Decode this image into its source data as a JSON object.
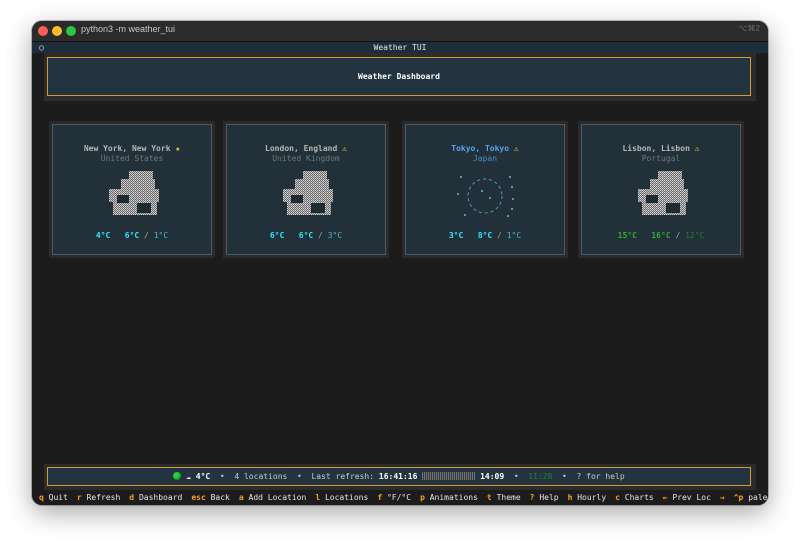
{
  "window": {
    "title": "python3 -m weather_tui",
    "shortcut": "⌥⌘2"
  },
  "app": {
    "title": "Weather TUI",
    "icon": "○"
  },
  "header": {
    "title": "Weather Dashboard"
  },
  "cards": [
    {
      "name": "New York, New York",
      "badge": "★",
      "country": "United States",
      "current": "4°C",
      "high": "6°C",
      "low": "1°C",
      "icon": "cloud-icon"
    },
    {
      "name": "London, England",
      "badge": "⚠",
      "country": "United Kingdom",
      "current": "6°C",
      "high": "6°C",
      "low": "3°C",
      "icon": "cloud-icon"
    },
    {
      "name": "Tokyo, Tokyo",
      "badge": "⚠",
      "country": "Japan",
      "current": "3°C",
      "high": "8°C",
      "low": "1°C",
      "icon": "moon-icon"
    },
    {
      "name": "Lisbon, Lisbon",
      "badge": "⚠",
      "country": "Portugal",
      "current": "15°C",
      "high": "16°C",
      "low": "12°C",
      "icon": "cloud-icon"
    }
  ],
  "status": {
    "weather": "☁ 4°C",
    "bullet": "•",
    "locations": "4 locations",
    "refresh_label": "Last refresh:",
    "refresh_time": "16:41:16",
    "countdown": "14:09",
    "dim_value": "11:28",
    "help": "? for help"
  },
  "footer": [
    {
      "key": "q",
      "label": "Quit"
    },
    {
      "key": "r",
      "label": "Refresh"
    },
    {
      "key": "d",
      "label": "Dashboard"
    },
    {
      "key": "esc",
      "label": "Back"
    },
    {
      "key": "a",
      "label": "Add Location"
    },
    {
      "key": "l",
      "label": "Locations"
    },
    {
      "key": "f",
      "label": "°F/°C"
    },
    {
      "key": "p",
      "label": "Animations"
    },
    {
      "key": "t",
      "label": "Theme"
    },
    {
      "key": "?",
      "label": "Help"
    },
    {
      "key": "h",
      "label": "Hourly"
    },
    {
      "key": "c",
      "label": "Charts"
    },
    {
      "key": "←",
      "label": "Prev Loc"
    },
    {
      "key": "→",
      "label": ""
    },
    {
      "key": "^p",
      "label": "palette"
    }
  ],
  "colors": {
    "accent_border": "#d49a33",
    "selected_city": "#54a7ee",
    "temp_cyan": "#33e6ff",
    "temp_green": "#2fae2f",
    "footer_key": "#f5a02a"
  }
}
